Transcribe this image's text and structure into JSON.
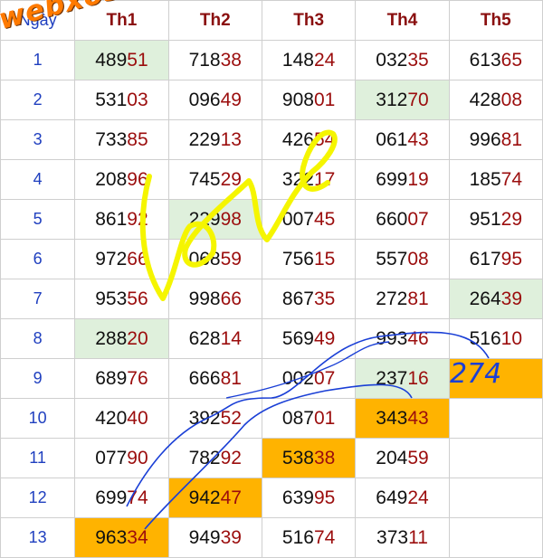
{
  "header": {
    "day_label": "Ngày",
    "cols": [
      "Th1",
      "Th2",
      "Th3",
      "Th4",
      "Th5"
    ]
  },
  "watermark": "webxoso.net",
  "handwritten_note": "274",
  "rows": [
    {
      "day": "1",
      "cells": [
        {
          "pre": "489",
          "suf": "51",
          "bg": "green"
        },
        {
          "pre": "718",
          "suf": "38"
        },
        {
          "pre": "148",
          "suf": "24"
        },
        {
          "pre": "032",
          "suf": "35"
        },
        {
          "pre": "613",
          "suf": "65"
        }
      ]
    },
    {
      "day": "2",
      "cells": [
        {
          "pre": "531",
          "suf": "03"
        },
        {
          "pre": "096",
          "suf": "49"
        },
        {
          "pre": "908",
          "suf": "01"
        },
        {
          "pre": "312",
          "suf": "70",
          "bg": "green"
        },
        {
          "pre": "428",
          "suf": "08"
        }
      ]
    },
    {
      "day": "3",
      "cells": [
        {
          "pre": "733",
          "suf": "85"
        },
        {
          "pre": "229",
          "suf": "13"
        },
        {
          "pre": "426",
          "suf": "54"
        },
        {
          "pre": "061",
          "suf": "43"
        },
        {
          "pre": "996",
          "suf": "81"
        }
      ]
    },
    {
      "day": "4",
      "cells": [
        {
          "pre": "208",
          "suf": "96"
        },
        {
          "pre": "745",
          "suf": "29"
        },
        {
          "pre": "322",
          "suf": "17"
        },
        {
          "pre": "699",
          "suf": "19"
        },
        {
          "pre": "185",
          "suf": "74"
        }
      ]
    },
    {
      "day": "5",
      "cells": [
        {
          "pre": "861",
          "suf": "92"
        },
        {
          "pre": "229",
          "suf": "98",
          "bg": "green"
        },
        {
          "pre": "007",
          "suf": "45"
        },
        {
          "pre": "660",
          "suf": "07"
        },
        {
          "pre": "951",
          "suf": "29"
        }
      ]
    },
    {
      "day": "6",
      "cells": [
        {
          "pre": "972",
          "suf": "66"
        },
        {
          "pre": "068",
          "suf": "59"
        },
        {
          "pre": "756",
          "suf": "15"
        },
        {
          "pre": "557",
          "suf": "08"
        },
        {
          "pre": "617",
          "suf": "95"
        }
      ]
    },
    {
      "day": "7",
      "cells": [
        {
          "pre": "953",
          "suf": "56"
        },
        {
          "pre": "998",
          "suf": "66"
        },
        {
          "pre": "867",
          "suf": "35"
        },
        {
          "pre": "272",
          "suf": "81"
        },
        {
          "pre": "264",
          "suf": "39",
          "bg": "green"
        }
      ]
    },
    {
      "day": "8",
      "cells": [
        {
          "pre": "288",
          "suf": "20",
          "bg": "green"
        },
        {
          "pre": "628",
          "suf": "14"
        },
        {
          "pre": "569",
          "suf": "49"
        },
        {
          "pre": "993",
          "suf": "46"
        },
        {
          "pre": "516",
          "suf": "10"
        }
      ]
    },
    {
      "day": "9",
      "cells": [
        {
          "pre": "689",
          "suf": "76"
        },
        {
          "pre": "666",
          "suf": "81"
        },
        {
          "pre": "002",
          "suf": "07"
        },
        {
          "pre": "237",
          "suf": "16",
          "bg": "green"
        },
        {
          "pre": "",
          "suf": "",
          "bg": "orange"
        }
      ]
    },
    {
      "day": "10",
      "cells": [
        {
          "pre": "420",
          "suf": "40"
        },
        {
          "pre": "392",
          "suf": "52"
        },
        {
          "pre": "087",
          "suf": "01"
        },
        {
          "pre": "343",
          "suf": "43",
          "bg": "orange"
        },
        {
          "pre": "",
          "suf": ""
        }
      ]
    },
    {
      "day": "11",
      "cells": [
        {
          "pre": "077",
          "suf": "90"
        },
        {
          "pre": "782",
          "suf": "92"
        },
        {
          "pre": "538",
          "suf": "38",
          "bg": "orange"
        },
        {
          "pre": "204",
          "suf": "59"
        },
        {
          "pre": "",
          "suf": ""
        }
      ]
    },
    {
      "day": "12",
      "cells": [
        {
          "pre": "699",
          "suf": "74"
        },
        {
          "pre": "942",
          "suf": "47",
          "bg": "orange"
        },
        {
          "pre": "639",
          "suf": "95"
        },
        {
          "pre": "649",
          "suf": "24"
        },
        {
          "pre": "",
          "suf": ""
        }
      ]
    },
    {
      "day": "13",
      "cells": [
        {
          "pre": "963",
          "suf": "34",
          "bg": "orange"
        },
        {
          "pre": "949",
          "suf": "39"
        },
        {
          "pre": "516",
          "suf": "74"
        },
        {
          "pre": "373",
          "suf": "11"
        },
        {
          "pre": "",
          "suf": ""
        }
      ]
    }
  ],
  "colors": {
    "highlight_green": "#dff0dc",
    "highlight_orange": "#ffb300",
    "suffix_red": "#9b0d0d",
    "day_blue": "#1f3fbf",
    "pen_blue": "#1a3fd6",
    "pen_yellow": "#f5f500"
  }
}
